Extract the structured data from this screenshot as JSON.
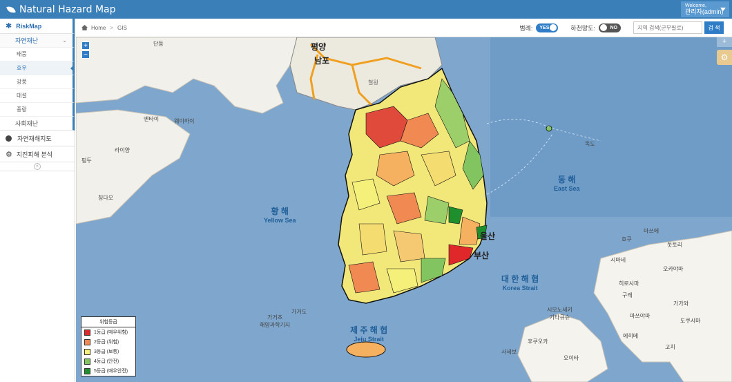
{
  "app": {
    "title": "Natural Hazard Map",
    "welcome": "Welcome,",
    "user": "관리자(admin)"
  },
  "sidebar": {
    "risk_map": "RiskMap",
    "natural": "자연재난",
    "items": [
      "태풍",
      "호우",
      "강풍",
      "대설",
      "풍랑"
    ],
    "active_index": 1,
    "social": "사회재난",
    "menus": [
      "자연재해지도",
      "지진피해 분석"
    ]
  },
  "toolbar": {
    "home": "Home",
    "page": "GIS",
    "legend_label": "범례:",
    "legend_toggle": "YES",
    "river_label": "하천망도:",
    "river_toggle": "NO",
    "search_placeholder": "지역 검색(군무필로)",
    "search_button": "검 색"
  },
  "map": {
    "labels": {
      "pyongyang": "평양",
      "nampo": "남포",
      "dandong": "단둥",
      "cheorwon": "철원",
      "yantai": "옌타이",
      "weihai": "웨이하이",
      "laiyang": "라이양",
      "pingdu": "핑두",
      "qingdao": "칭다오",
      "dokdo": "독도",
      "ulsan": "울산",
      "busan": "부산",
      "hujyu": "호쿠",
      "matsue": "마쓰에",
      "tottori": "돗토리",
      "shimane": "시마네",
      "okayama": "오카야마",
      "hiroshima": "히로시마",
      "kure": "구레",
      "kagawa": "가가와",
      "tokushima": "도쿠시마",
      "yamaguchi": "시모노세키\n기타큐슈",
      "matsuyama": "마쓰야마",
      "ehime": "에히메",
      "kochi": "고치",
      "fukuoka": "후쿠오카",
      "saseo": "사세보",
      "oita": "오이타",
      "gageocho": "가거초\n해양과학기지",
      "gageodo": "가거도"
    },
    "seas": {
      "yellow": {
        "ko": "황 해",
        "en": "Yellow Sea"
      },
      "east": {
        "ko": "동 해",
        "en": "East Sea"
      },
      "korea_strait": {
        "ko": "대 한 해 협",
        "en": "Korea Strait"
      },
      "jeju_strait": {
        "ko": "제 주 해 협",
        "en": "Jeju Strait"
      }
    },
    "zoom_in": "+",
    "zoom_out": "−"
  },
  "legend": {
    "title": "위험등급",
    "entries": [
      {
        "label": "1등급 (매우위험)",
        "color": "#e0282a"
      },
      {
        "label": "2등급 (위험)",
        "color": "#f08a52"
      },
      {
        "label": "3등급 (보통)",
        "color": "#f5f07a"
      },
      {
        "label": "4등급 (안전)",
        "color": "#82c460"
      },
      {
        "label": "5등급 (매우안전)",
        "color": "#1f8f2d"
      }
    ]
  }
}
